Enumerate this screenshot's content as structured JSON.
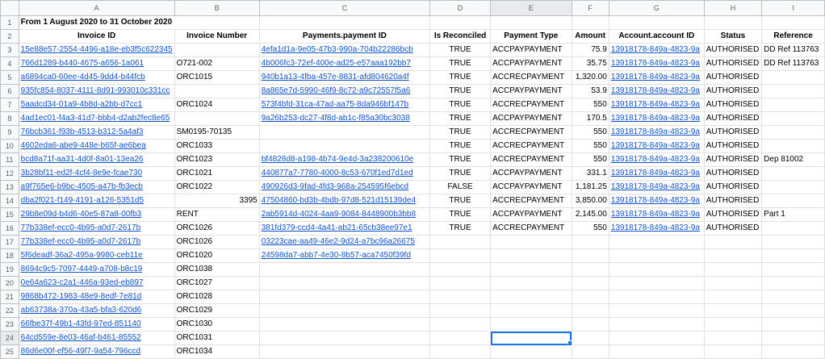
{
  "sheet": {
    "columns": [
      "A",
      "B",
      "C",
      "D",
      "E",
      "F",
      "G",
      "H",
      "I"
    ],
    "rows": [
      1,
      2,
      3,
      4,
      5,
      6,
      7,
      8,
      9,
      10,
      11,
      12,
      13,
      14,
      15,
      16,
      17,
      18,
      19,
      20,
      21,
      22,
      23,
      24,
      25
    ],
    "selected_row": "24",
    "selected_col": "E",
    "title": "From 1 August 2020 to 31 October 2020",
    "headers": [
      "Invoice ID",
      "Invoice Number",
      "Payments.payment ID",
      "Is Reconciled",
      "Payment Type",
      "Amount",
      "Account.account ID",
      "Status",
      "Reference"
    ],
    "data": [
      [
        "15e88e57-2554-4496-a18e-eb3f5c622345",
        "",
        "4efa1d1a-9e05-47b3-990a-704b22286bcb",
        "TRUE",
        "ACCPAYPAYMENT",
        "75.9",
        "13918178-849a-4823-9a",
        "AUTHORISED",
        "DD Ref 113763"
      ],
      [
        "766d1289-b440-4675-a656-1a061",
        "O721-002",
        "4b006fc3-72ef-400e-ad25-e57aaa192bb7",
        "TRUE",
        "ACCPAYPAYMENT",
        "35.75",
        "13918178-849a-4823-9a",
        "AUTHORISED",
        "DD Ref 113763"
      ],
      [
        "a6894ca0-60ee-4d45-9dd4-b44fcb",
        "ORC1015",
        "940b1a13-4fba-457e-8831-afd804620a4f",
        "TRUE",
        "ACCRECPAYMENT",
        "1,320.00",
        "13918178-849a-4823-9a",
        "AUTHORISED",
        ""
      ],
      [
        "935fc854-8037-4111-8d91-993010c331cc",
        "",
        "8a865e7d-5990-46f9-8c72-a9c72557f5a6",
        "TRUE",
        "ACCPAYPAYMENT",
        "53.9",
        "13918178-849a-4823-9a",
        "AUTHORISED",
        ""
      ],
      [
        "5aadcd34-01a9-4b8d-a2bb-d7cc1",
        "ORC1024",
        "573f4bfd-31ca-47ad-aa75-8da946bf147b",
        "TRUE",
        "ACCRECPAYMENT",
        "550",
        "13918178-849a-4823-9a",
        "AUTHORISED",
        ""
      ],
      [
        "4ad1ec01-f4a3-41d7-bbb4-d2ab2fec8e65",
        "",
        "9a26b253-dc27-4f8d-ab1c-f85a30bc3038",
        "TRUE",
        "ACCPAYPAYMENT",
        "170.5",
        "13918178-849a-4823-9a",
        "AUTHORISED",
        ""
      ],
      [
        "76bcb361-f93b-4513-b312-5a4af3",
        "SM0195-70135",
        "",
        "TRUE",
        "ACCRECPAYMENT",
        "550",
        "13918178-849a-4823-9a",
        "AUTHORISED",
        ""
      ],
      [
        "4602eda6-abe9-448e-b65f-ae6bea",
        "ORC1033",
        "",
        "TRUE",
        "ACCRECPAYMENT",
        "550",
        "13918178-849a-4823-9a",
        "AUTHORISED",
        ""
      ],
      [
        "bcd8a71f-aa31-4d0f-8a01-13ea26",
        "ORC1023",
        "bf4828d8-a198-4b74-9e4d-3a238200610e",
        "TRUE",
        "ACCRECPAYMENT",
        "550",
        "13918178-849a-4823-9a",
        "AUTHORISED",
        "Dep 81002"
      ],
      [
        "3b28bf11-ed2f-4cf4-8e9e-fcae730",
        "ORC1021",
        "440877a7-7780-4000-8c53-670f1ed7d1ed",
        "TRUE",
        "ACCPAYPAYMENT",
        "331.1",
        "13918178-849a-4823-9a",
        "AUTHORISED",
        ""
      ],
      [
        "a9f765e6-b9bc-4505-a47b-fb3ecb",
        "ORC1022",
        "490926d3-9fad-4fd3-968a-254595f6ebcd",
        "FALSE",
        "ACCPAYPAYMENT",
        "1,181.25",
        "13918178-849a-4823-9a",
        "AUTHORISED",
        ""
      ],
      [
        "dba2f021-f149-4191-a126-5351d5",
        "3395",
        "47504860-bd3b-4bdb-97d8-521d15139de4",
        "TRUE",
        "ACCRECPAYMENT",
        "3,850.00",
        "13918178-849a-4823-9a",
        "AUTHORISED",
        ""
      ],
      [
        "29b8e09d-b4d6-40e5-87a8-00fb3",
        "RENT",
        "2ab5914d-4024-4aa9-9084-8448900b3bb8",
        "TRUE",
        "ACCPAYPAYMENT",
        "2,145.00",
        "13918178-849a-4823-9a",
        "AUTHORISED",
        "Part 1"
      ],
      [
        "77b338ef-ecc0-4b95-a0d7-2617b",
        "ORC1026",
        "381fd379-ccd4-4a41-ab21-65cb38ee97e1",
        "TRUE",
        "ACCRECPAYMENT",
        "550",
        "13918178-849a-4823-9a",
        "AUTHORISED",
        ""
      ],
      [
        "77b338ef-ecc0-4b95-a0d7-2617b",
        "ORC1026",
        "03223cae-aa49-46e2-9d24-a7bc96a26675",
        "",
        "",
        "",
        "",
        "",
        ""
      ],
      [
        "5f6deadf-36a2-495a-9980-ceb11e",
        "ORC1020",
        "24598da7-abb7-4e30-8b57-aca7450f39fd",
        "",
        "",
        "",
        "",
        "",
        ""
      ],
      [
        "8694c9c5-7097-4449-a708-b8c19",
        "ORC1038",
        "",
        "",
        "",
        "",
        "",
        "",
        ""
      ],
      [
        "0e64a623-c2a1-446a-93ed-eb897",
        "ORC1027",
        "",
        "",
        "",
        "",
        "",
        "",
        ""
      ],
      [
        "9868b472-1983-48e9-8edf-7e81d",
        "ORC1028",
        "",
        "",
        "",
        "",
        "",
        "",
        ""
      ],
      [
        "ab63738a-370a-43a5-bfa3-620d6",
        "ORC1029",
        "",
        "",
        "",
        "",
        "",
        "",
        ""
      ],
      [
        "66fbe37f-49b1-43fd-97ed-851140",
        "ORC1030",
        "",
        "",
        "",
        "",
        "",
        "",
        ""
      ],
      [
        "64cd559e-8e03-46af-b461-85552",
        "ORC1031",
        "",
        "",
        "",
        "",
        "",
        "",
        ""
      ],
      [
        "86d6e00f-ef56-49f7-9a54-796ccd",
        "ORC1034",
        "",
        "",
        "",
        "",
        "",
        "",
        ""
      ]
    ]
  }
}
